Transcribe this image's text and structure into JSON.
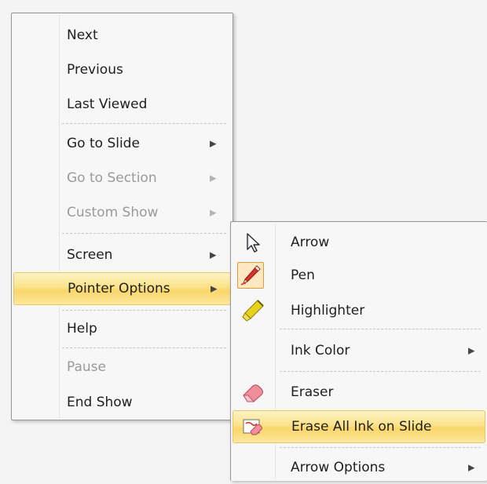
{
  "main_menu": {
    "next": "Next",
    "previous": "Previous",
    "last_viewed": "Last Viewed",
    "go_to_slide": "Go to Slide",
    "go_to_section": "Go to Section",
    "custom_show": "Custom Show",
    "screen": "Screen",
    "pointer_options": "Pointer Options",
    "help": "Help",
    "pause": "Pause",
    "end_show": "End Show"
  },
  "pointer_submenu": {
    "arrow": "Arrow",
    "pen": "Pen",
    "highlighter": "Highlighter",
    "ink_color": "Ink Color",
    "eraser": "Eraser",
    "erase_all": "Erase All Ink on Slide",
    "arrow_options": "Arrow Options"
  },
  "submenu_arrow_glyph": "▶",
  "colors": {
    "highlight": "#f9d66a",
    "pen_red": "#d8342c",
    "highlighter_yellow": "#e8d31c",
    "disabled_text": "#9a9a9a"
  },
  "icons": [
    "arrow-cursor-icon",
    "pen-icon",
    "highlighter-icon",
    "eraser-icon",
    "erase-all-ink-icon"
  ]
}
